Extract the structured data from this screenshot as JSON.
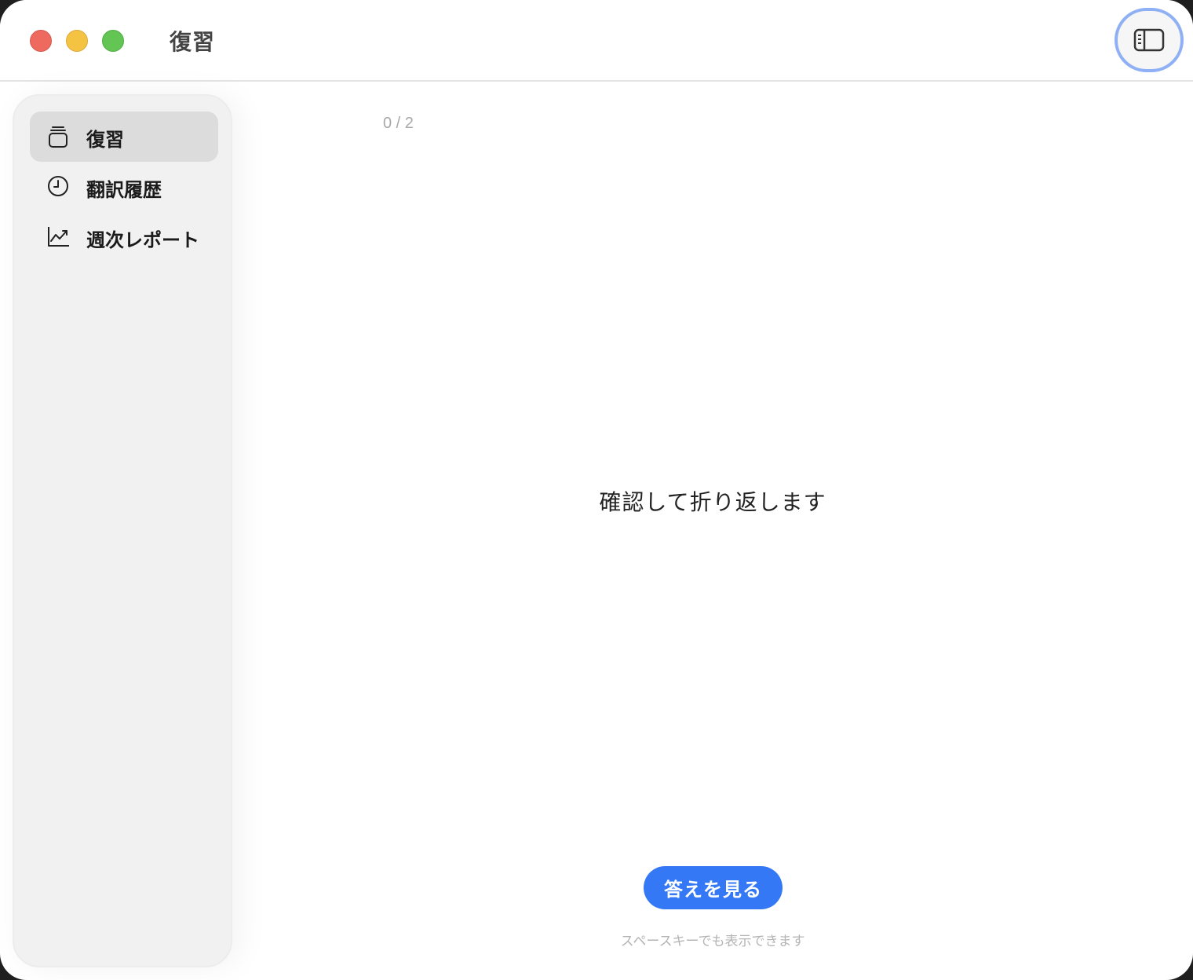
{
  "window": {
    "title": "復習"
  },
  "titlebar": {
    "traffic_lights": {
      "close_color": "#ee6a5f",
      "minimize_color": "#f5c342",
      "maximize_color": "#62c554"
    },
    "sidebar_toggle_icon": "sidebar-toggle-icon"
  },
  "sidebar": {
    "items": [
      {
        "label": "復習",
        "icon": "flashcards-icon",
        "active": true
      },
      {
        "label": "翻訳履歴",
        "icon": "clock-icon",
        "active": false
      },
      {
        "label": "週次レポート",
        "icon": "chart-line-icon",
        "active": false
      }
    ]
  },
  "review": {
    "progress": "0 / 2",
    "card_text": "確認して折り返します",
    "answer_button": "答えを見る",
    "hint": "スペースキーでも表示できます"
  },
  "colors": {
    "accent": "#3478f6",
    "focus_ring": "#8fb0f5"
  }
}
